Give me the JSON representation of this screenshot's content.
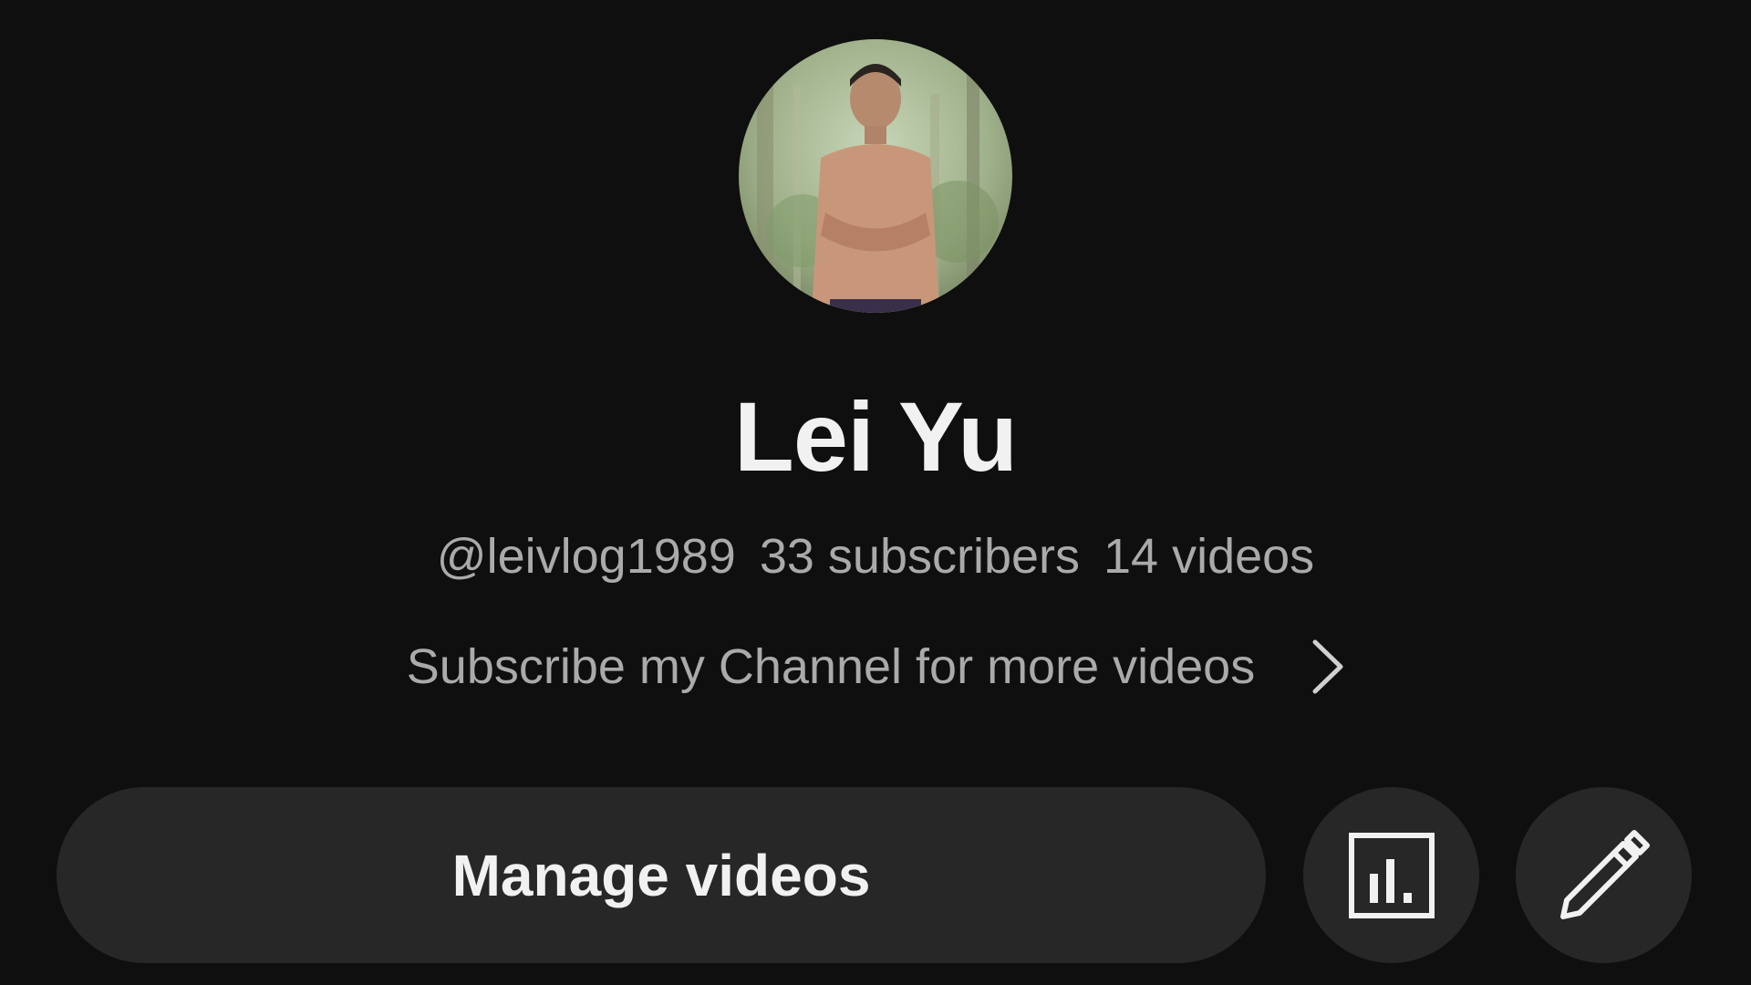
{
  "channel": {
    "name": "Lei Yu",
    "handle": "@leivlog1989",
    "subscribers": "33 subscribers",
    "videos": "14 videos",
    "description": "Subscribe my Channel for more videos"
  },
  "actions": {
    "manage_label": "Manage videos",
    "analytics_icon": "analytics-icon",
    "edit_icon": "pencil-icon"
  },
  "colors": {
    "background": "#0f0f0f",
    "button_bg": "#272727",
    "primary_text": "#f1f1f1",
    "secondary_text": "#aaaaaa"
  }
}
